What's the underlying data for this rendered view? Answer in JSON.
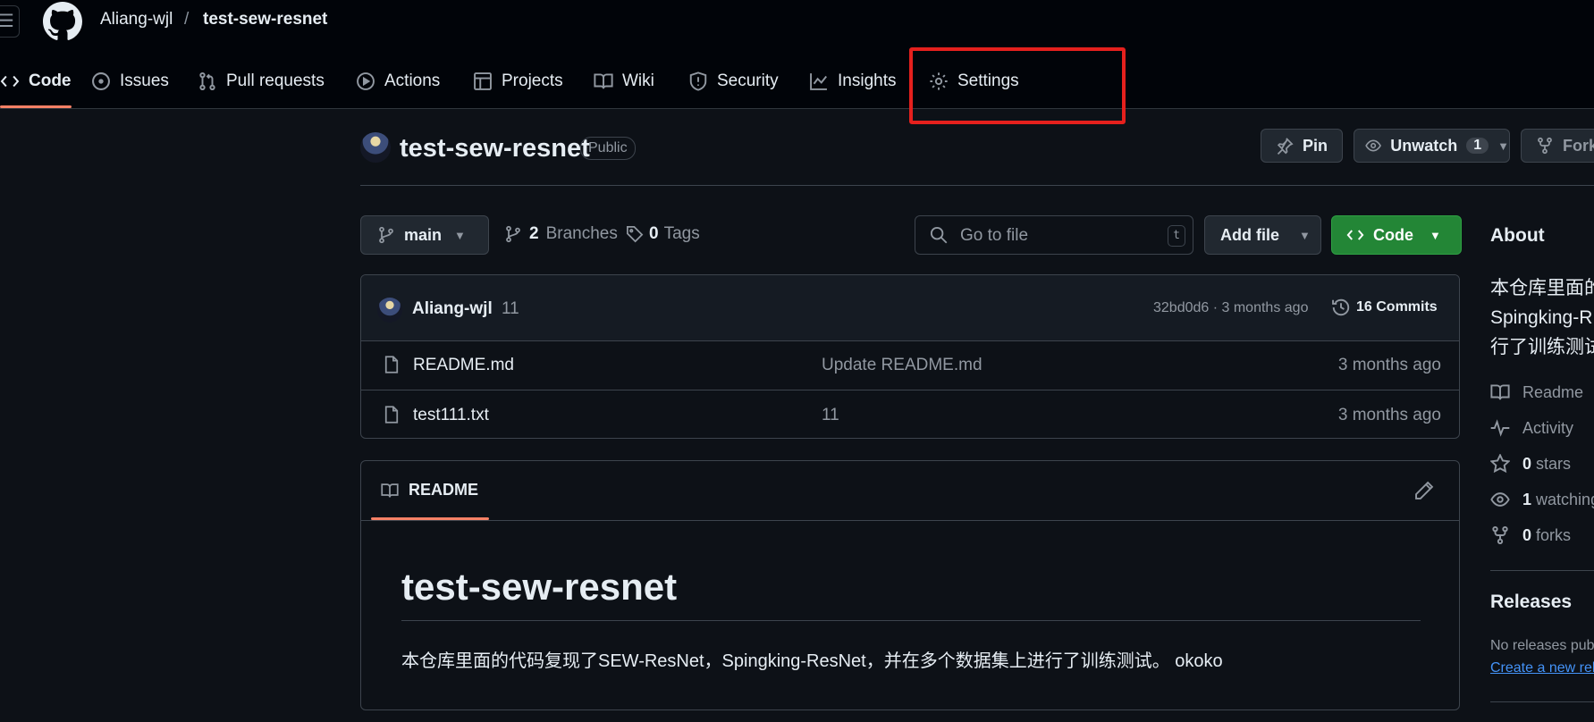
{
  "header": {
    "owner": "Aliang-wjl",
    "separator": "/",
    "repo": "test-sew-resnet",
    "menu_icon": "hamburger-icon",
    "logo_icon": "github-logo-icon"
  },
  "tabs": [
    {
      "label": "Code",
      "icon": "code-icon"
    },
    {
      "label": "Issues",
      "icon": "issue-icon"
    },
    {
      "label": "Pull requests",
      "icon": "pull-request-icon"
    },
    {
      "label": "Actions",
      "icon": "play-icon"
    },
    {
      "label": "Projects",
      "icon": "table-icon"
    },
    {
      "label": "Wiki",
      "icon": "book-icon"
    },
    {
      "label": "Security",
      "icon": "shield-icon"
    },
    {
      "label": "Insights",
      "icon": "graph-icon"
    },
    {
      "label": "Settings",
      "icon": "gear-icon"
    }
  ],
  "repo_header": {
    "name": "test-sew-resnet",
    "visibility": "Public",
    "pin_label": "Pin",
    "unwatch_label": "Unwatch",
    "watch_count": "1",
    "fork_label": "Fork"
  },
  "toolbar": {
    "branch": "main",
    "branches_count": "2",
    "branches_label": "Branches",
    "tags_count": "0",
    "tags_label": "Tags",
    "search_placeholder": "Go to file",
    "search_shortcut": "t",
    "add_file_label": "Add file",
    "code_label": "Code"
  },
  "latest_commit": {
    "author": "Aliang-wjl",
    "message": "11",
    "hash_time": "32bd0d6 · 3 months ago",
    "commits_label": "16 Commits"
  },
  "files": [
    {
      "name": "README.md",
      "message": "Update README.md",
      "time": "3 months ago"
    },
    {
      "name": "test111.txt",
      "message": "11",
      "time": "3 months ago"
    }
  ],
  "readme": {
    "tab_label": "README",
    "heading": "test-sew-resnet",
    "body": "本仓库里面的代码复现了SEW-ResNet，Spingking-ResNet，并在多个数据集上进行了训练测试。 okoko"
  },
  "about": {
    "title": "About",
    "description_lines": [
      "本仓库里面的",
      "Spingking-R",
      "行了训练测试"
    ],
    "readme_label": "Readme",
    "activity_label": "Activity",
    "stars_count": "0",
    "stars_label": "stars",
    "watching_count": "1",
    "watching_label": "watching",
    "forks_count": "0",
    "forks_label": "forks"
  },
  "releases": {
    "title": "Releases",
    "none_text": "No releases published",
    "create_link": "Create a new release"
  },
  "colors": {
    "background": "#0d1117",
    "topbar": "#010409",
    "accent_underline": "#f78166",
    "code_button": "#238636",
    "highlight_box": "#e5201d",
    "link": "#4493f8"
  }
}
